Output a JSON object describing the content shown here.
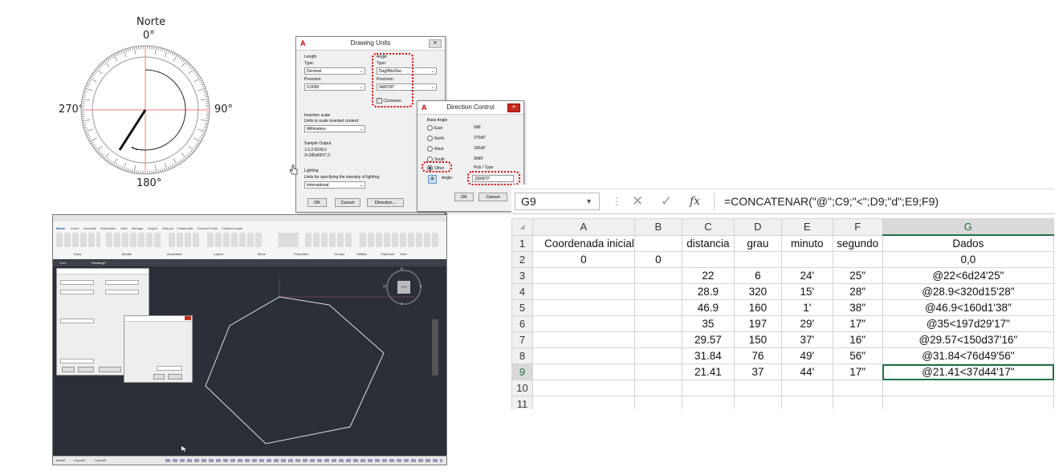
{
  "compass": {
    "north_label": "Norte",
    "north_value": "0°",
    "east_value": "90°",
    "south_value": "180°",
    "west_value": "270°"
  },
  "drawing_units": {
    "title": "Drawing Units",
    "length_group": "Length",
    "length_type_label": "Type:",
    "length_type": "Decimal",
    "length_precision_label": "Precision:",
    "length_precision": "0.0000",
    "angle_group": "Angle",
    "angle_type_label": "Type:",
    "angle_type": "Deg/Min/Sec",
    "angle_precision_label": "Precision:",
    "angle_precision": "0d00'00\"",
    "clockwise_label": "Clockwise",
    "insertion_group": "Insertion scale",
    "insertion_desc": "Units to scale inserted content:",
    "insertion_value": "Millimeters",
    "sample_group": "Sample Output",
    "sample_line1": "1.5,2.0039,0",
    "sample_line2": "3<285d00'0\",0",
    "lighting_group": "Lighting",
    "lighting_desc": "Units for specifying the intensity of lighting:",
    "lighting_value": "International",
    "ok": "OK",
    "cancel": "Cancel",
    "direction": "Direction..."
  },
  "direction_control": {
    "title": "Direction Control",
    "base_angle": "Base Angle",
    "options": [
      {
        "label": "East",
        "value": "0d0'"
      },
      {
        "label": "North",
        "value": "270d0'"
      },
      {
        "label": "West",
        "value": "180d0'"
      },
      {
        "label": "South",
        "value": "90d0'"
      },
      {
        "label": "Other",
        "value": "Pick / Type"
      }
    ],
    "angle_label": "Angle:",
    "angle_value": "330d0'0\"",
    "ok": "OK",
    "cancel": "Cancel"
  },
  "cad": {
    "ribbon_tabs": [
      "Home",
      "Insert",
      "Annotate",
      "Parametric",
      "View",
      "Manage",
      "Output",
      "Add-ins",
      "Collaborate",
      "Express Tools",
      "Featured Apps"
    ],
    "panels": [
      "Draw",
      "Modify",
      "Annotation",
      "Layers",
      "Block",
      "Properties",
      "Groups",
      "Utilities",
      "Clipboard",
      "View"
    ],
    "file_tabs": [
      "Start",
      "Drawing1*"
    ],
    "viewcube_label": "TOP",
    "compass_letters": [
      "N",
      "W",
      "E",
      "S"
    ],
    "status_tabs": [
      "Model",
      "Layout1",
      "Layout2"
    ]
  },
  "spreadsheet": {
    "name_box": "G9",
    "fx_symbol": "fx",
    "cancel_symbol": "✕",
    "enter_symbol": "✓",
    "formula": "=CONCATENAR(\"@\";C9;\"<\";D9;\"d\";E9;F9)",
    "column_headers": [
      "A",
      "B",
      "C",
      "D",
      "E",
      "F",
      "G"
    ],
    "rows": [
      {
        "n": "1",
        "cells": [
          "Coordenada inicial",
          "",
          "distancia",
          "grau",
          "minuto",
          "segundo",
          "Dados"
        ]
      },
      {
        "n": "2",
        "cells": [
          "0",
          "0",
          "",
          "",
          "",
          "",
          "0,0"
        ]
      },
      {
        "n": "3",
        "cells": [
          "",
          "",
          "22",
          "6",
          "24'",
          "25\"",
          "@22<6d24'25\""
        ]
      },
      {
        "n": "4",
        "cells": [
          "",
          "",
          "28.9",
          "320",
          "15'",
          "28\"",
          "@28.9<320d15'28\""
        ]
      },
      {
        "n": "5",
        "cells": [
          "",
          "",
          "46.9",
          "160",
          "1'",
          "38\"",
          "@46.9<160d1'38\""
        ]
      },
      {
        "n": "6",
        "cells": [
          "",
          "",
          "35",
          "197",
          "29'",
          "17\"",
          "@35<197d29'17\""
        ]
      },
      {
        "n": "7",
        "cells": [
          "",
          "",
          "29.57",
          "150",
          "37'",
          "16\"",
          "@29.57<150d37'16\""
        ]
      },
      {
        "n": "8",
        "cells": [
          "",
          "",
          "31.84",
          "76",
          "49'",
          "56\"",
          "@31.84<76d49'56\""
        ]
      },
      {
        "n": "9",
        "cells": [
          "",
          "",
          "21.41",
          "37",
          "44'",
          "17\"",
          "@21.41<37d44'17\""
        ]
      },
      {
        "n": "10",
        "cells": [
          "",
          "",
          "",
          "",
          "",
          "",
          ""
        ]
      },
      {
        "n": "11",
        "cells": [
          "",
          "",
          "",
          "",
          "",
          "",
          ""
        ]
      }
    ],
    "active_cell": "G9",
    "accent_color": "#217346"
  },
  "colors": {
    "highlight_red": "#dd0000",
    "cad_background": "#2a2f38"
  }
}
